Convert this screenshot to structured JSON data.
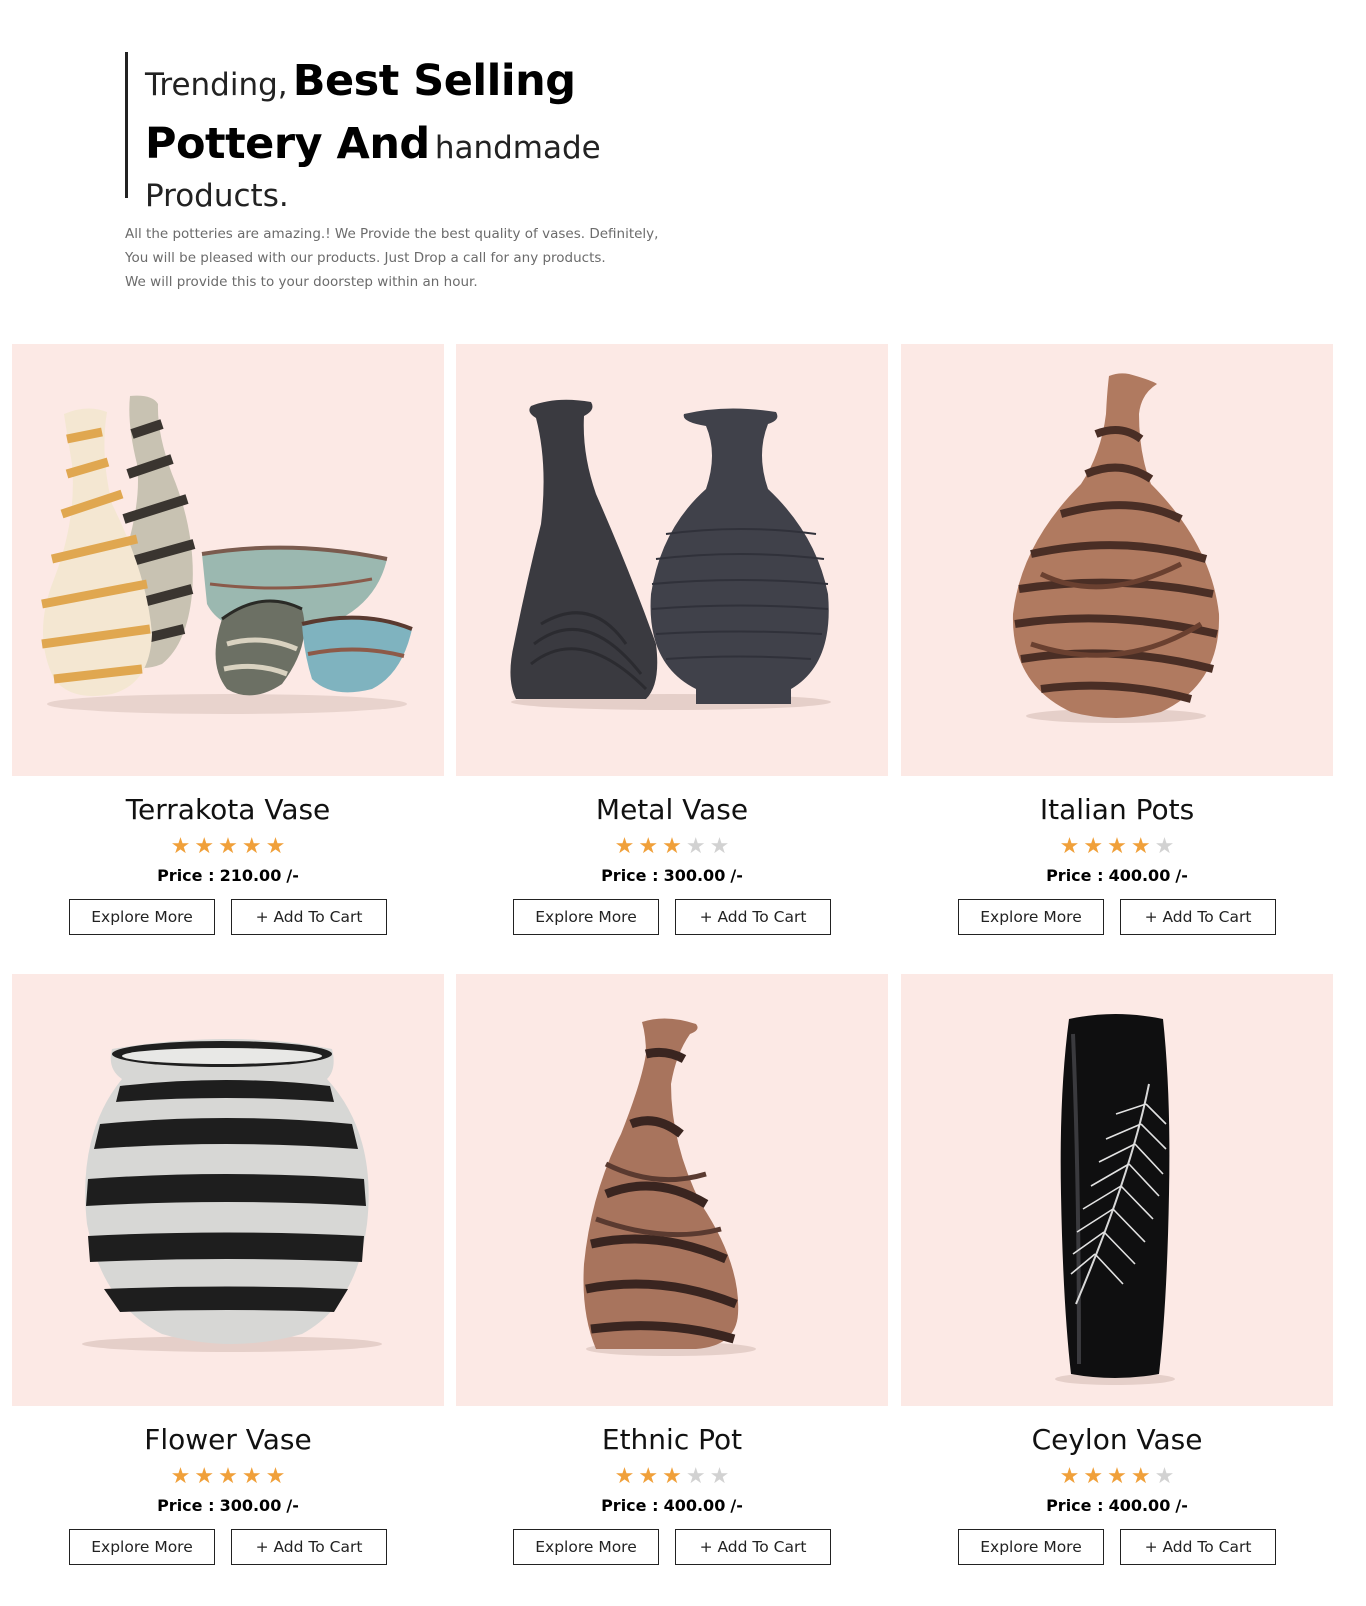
{
  "hero": {
    "trending": "Trending,",
    "best_selling": "Best Selling",
    "pottery_and": "Pottery And",
    "handmade": "handmade",
    "products": "Products.",
    "description_lines": [
      "All the potteries are amazing.! We Provide the best quality of vases. Definitely,",
      "You will be pleased with our products. Just Drop a call for any products.",
      "We will provide this to your doorstep within an hour."
    ]
  },
  "colors": {
    "card_bg": "#fce9e5",
    "star_on": "#f0a03a",
    "star_off": "#d2d2d2"
  },
  "products": [
    {
      "name": "Terrakota Vase",
      "rating": 5,
      "price_label": "Price :",
      "price": "210.00",
      "price_suffix": "/-",
      "explore": "Explore More",
      "cart": "+ Add To Cart",
      "image": "striped-vases-and-bowls"
    },
    {
      "name": "Metal Vase",
      "rating": 3,
      "price_label": "Price :",
      "price": "300.00",
      "price_suffix": "/-",
      "explore": "Explore More",
      "cart": "+ Add To Cart",
      "image": "two-black-vases"
    },
    {
      "name": "Italian Pots",
      "rating": 4,
      "price_label": "Price :",
      "price": "400.00",
      "price_suffix": "/-",
      "explore": "Explore More",
      "cart": "+ Add To Cart",
      "image": "brown-textured-vase"
    },
    {
      "name": "Flower Vase",
      "rating": 5,
      "price_label": "Price :",
      "price": "300.00",
      "price_suffix": "/-",
      "explore": "Explore More",
      "cart": "+ Add To Cart",
      "image": "black-white-striped-pot"
    },
    {
      "name": "Ethnic Pot",
      "rating": 3,
      "price_label": "Price :",
      "price": "400.00",
      "price_suffix": "/-",
      "explore": "Explore More",
      "cart": "+ Add To Cart",
      "image": "slanted-brown-vase"
    },
    {
      "name": "Ceylon Vase",
      "rating": 4,
      "price_label": "Price :",
      "price": "400.00",
      "price_suffix": "/-",
      "explore": "Explore More",
      "cart": "+ Add To Cart",
      "image": "black-feather-cylinder-vase"
    }
  ]
}
